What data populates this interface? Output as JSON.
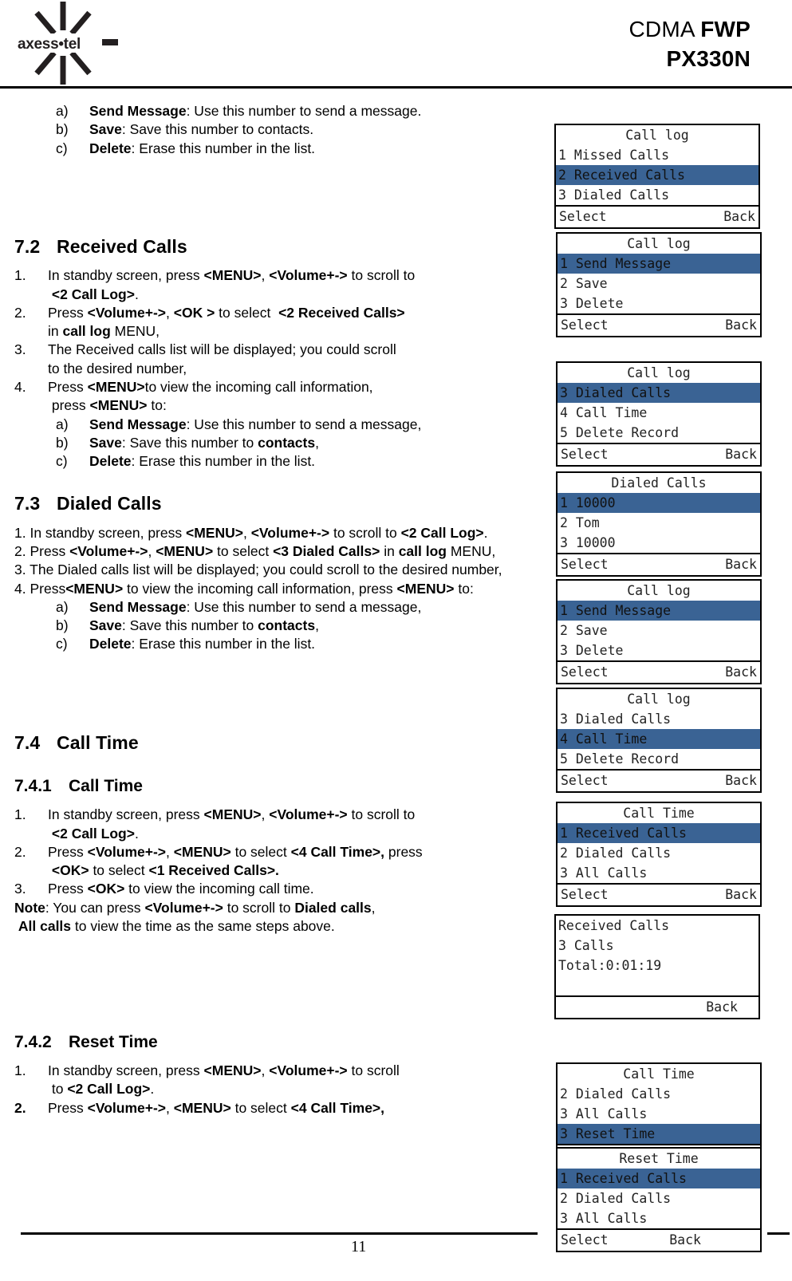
{
  "header": {
    "logo_text": "axess•tel",
    "logo_icon": "starburst-logo",
    "title_line1_normal": "CDMA ",
    "title_line1_bold": "FWP",
    "title_line2": "PX330N"
  },
  "body": {
    "top_list": [
      {
        "marker": "a)",
        "bold": "Send Message",
        "rest": ": Use this number to send a message."
      },
      {
        "marker": "b)",
        "bold": "Save",
        "rest": ": Save this number to contacts."
      },
      {
        "marker": "c)",
        "bold": "Delete",
        "rest": ": Erase this number in the list."
      }
    ],
    "s72": {
      "num": "7.2",
      "title": "Received Calls",
      "steps": [
        {
          "marker": "1.",
          "html": "In standby screen, press <b>&lt;MENU&gt;</b>, <b>&lt;Volume+-&gt;</b> to scroll to <br>&nbsp;<b>&lt;2 Call Log&gt;</b>."
        },
        {
          "marker": "2.",
          "html": "Press <b>&lt;Volume+-&gt;</b>, <b>&lt;OK &gt;</b> to select&nbsp; <b>&lt;2 Received Calls&gt;</b> <br>in <b>call log</b> MENU,"
        },
        {
          "marker": "3.",
          "html": "The Received calls list will be displayed; you could scroll <br>to the desired number,"
        },
        {
          "marker": "4.",
          "html": "Press <b>&lt;MENU&gt;</b>to view the incoming call information, <br>&nbsp;press <b>&lt;MENU&gt;</b> to:"
        }
      ],
      "sub_list": [
        {
          "marker": "a)",
          "html": "<b>Send Message</b>: Use this number to send a message,"
        },
        {
          "marker": "b)",
          "html": "<b>Save</b>: Save this number to <b>contacts</b>,"
        },
        {
          "marker": "c)",
          "html": "<b>Delete</b>: Erase this number in the list."
        }
      ]
    },
    "s73": {
      "num": "7.3",
      "title": "Dialed Calls",
      "paras": [
        "1. In standby screen, press <b>&lt;MENU&gt;</b>, <b>&lt;Volume+-&gt;</b> to scroll to <b>&lt;2 Call Log&gt;</b>.",
        "2. Press <b>&lt;Volume+-&gt;</b>, <b>&lt;MENU&gt;</b> to select <b>&lt;3 Dialed Calls&gt;</b> in <b>call log</b> MENU,",
        "3. The Dialed calls list will be displayed; you could scroll to the desired number,",
        "4. Press<b>&lt;MENU&gt;</b> to view the incoming call information, press <b>&lt;MENU&gt;</b> to:"
      ],
      "sub_list": [
        {
          "marker": "a)",
          "html": "<b>Send Message</b>: Use this number to send a message,"
        },
        {
          "marker": "b)",
          "html": "<b>Save</b>: Save this number to <b>contacts</b>,"
        },
        {
          "marker": "c)",
          "html": "<b>Delete</b>: Erase this number in the list."
        }
      ]
    },
    "s74": {
      "num": "7.4",
      "title": "Call Time"
    },
    "s741": {
      "num": "7.4.1",
      "title": "Call Time",
      "steps": [
        {
          "marker": "1.",
          "html": "In standby screen, press <b>&lt;MENU&gt;</b>, <b>&lt;Volume+-&gt;</b> to scroll to <br>&nbsp;<b>&lt;2 Call Log&gt;</b>."
        },
        {
          "marker": "2.",
          "html": "Press <b>&lt;Volume+-&gt;</b>, <b>&lt;MENU&gt;</b> to select <b>&lt;4 Call Time&gt;,</b> press <br>&nbsp;<b>&lt;OK&gt;</b> to select <b>&lt;1 Received Calls&gt;.</b>"
        },
        {
          "marker": "3.",
          "html": "Press <b>&lt;OK&gt;</b> to view the incoming call time."
        }
      ],
      "note": "<b>Note</b>: You can press <b>&lt;Volume+-&gt;</b> to scroll to <b>Dialed calls</b>,<br>&nbsp;<b>All calls</b> to view the time as the same steps above."
    },
    "s742": {
      "num": "7.4.2",
      "title": "Reset Time",
      "steps": [
        {
          "marker": "1.",
          "html": "In standby screen, press <b>&lt;MENU&gt;</b>, <b>&lt;Volume+-&gt;</b> to scroll <br>&nbsp;to <b>&lt;2 Call Log&gt;</b>."
        },
        {
          "marker": "2.",
          "bold_marker": true,
          "html": "Press <b>&lt;Volume+-&gt;</b>, <b>&lt;MENU&gt;</b> to select <b>&lt;4 Call Time&gt;,</b>"
        }
      ]
    }
  },
  "screens": [
    {
      "id": "call-log-received",
      "title": "Call log",
      "rows": [
        {
          "text": "1 Missed Calls",
          "selected": false
        },
        {
          "text": "2 Received Calls",
          "selected": true
        },
        {
          "text": "3 Dialed Calls",
          "selected": false
        }
      ],
      "footer_left": "Select",
      "footer_right": "Back"
    },
    {
      "id": "call-log-options-1",
      "title": "Call log",
      "rows": [
        {
          "text": "1 Send Message",
          "selected": true
        },
        {
          "text": "2 Save",
          "selected": false
        },
        {
          "text": "3 Delete",
          "selected": false
        }
      ],
      "footer_left": "Select",
      "footer_right": "Back"
    },
    {
      "id": "call-log-dialed",
      "title": "Call log",
      "rows": [
        {
          "text": "3 Dialed Calls",
          "selected": true
        },
        {
          "text": "4 Call Time",
          "selected": false
        },
        {
          "text": "5 Delete Record",
          "selected": false
        }
      ],
      "footer_left": "Select",
      "footer_right": "Back"
    },
    {
      "id": "dialed-calls-list",
      "title": "Dialed Calls",
      "rows": [
        {
          "text": "1 10000",
          "selected": true
        },
        {
          "text": "2 Tom",
          "selected": false
        },
        {
          "text": "3 10000",
          "selected": false
        }
      ],
      "footer_left": "Select",
      "footer_right": "Back"
    },
    {
      "id": "call-log-options-2",
      "title": "Call log",
      "rows": [
        {
          "text": "1 Send Message",
          "selected": true
        },
        {
          "text": "2 Save",
          "selected": false
        },
        {
          "text": "3 Delete",
          "selected": false
        }
      ],
      "footer_left": "Select",
      "footer_right": "Back"
    },
    {
      "id": "call-log-call-time",
      "title": "Call log",
      "rows": [
        {
          "text": "3 Dialed Calls",
          "selected": false
        },
        {
          "text": "4 Call Time",
          "selected": true
        },
        {
          "text": "5 Delete Record",
          "selected": false
        }
      ],
      "footer_left": "Select",
      "footer_right": "Back"
    },
    {
      "id": "call-time-menu",
      "title": "Call Time",
      "rows": [
        {
          "text": "1 Received Calls",
          "selected": true
        },
        {
          "text": "2 Dialed Calls",
          "selected": false
        },
        {
          "text": "3 All Calls",
          "selected": false
        }
      ],
      "footer_left": "Select",
      "footer_right": "Back"
    },
    {
      "id": "received-calls-total",
      "title": "",
      "rows": [
        {
          "text": "Received Calls",
          "selected": false
        },
        {
          "text": "3 Calls",
          "selected": false
        },
        {
          "text": "Total:0:01:19",
          "selected": false
        },
        {
          "text": "",
          "selected": false
        }
      ],
      "footer_left": "",
      "footer_right": "Back"
    },
    {
      "id": "call-time-reset",
      "title": "Call Time",
      "rows": [
        {
          "text": "2 Dialed Calls",
          "selected": false
        },
        {
          "text": "3 All Calls",
          "selected": false
        },
        {
          "text": "3 Reset Time",
          "selected": true
        }
      ],
      "footer_left": "Select",
      "footer_right": "Back"
    },
    {
      "id": "reset-time-menu",
      "title": "Reset Time",
      "rows": [
        {
          "text": "1 Received Calls",
          "selected": true
        },
        {
          "text": "2 Dialed Calls",
          "selected": false
        },
        {
          "text": "3 All Calls",
          "selected": false
        }
      ],
      "footer_left": "Select",
      "footer_right": "Back"
    }
  ],
  "footer": {
    "page_number": "11"
  },
  "colors": {
    "highlight": "#3a6394",
    "text": "#222222",
    "rule": "#000000"
  }
}
